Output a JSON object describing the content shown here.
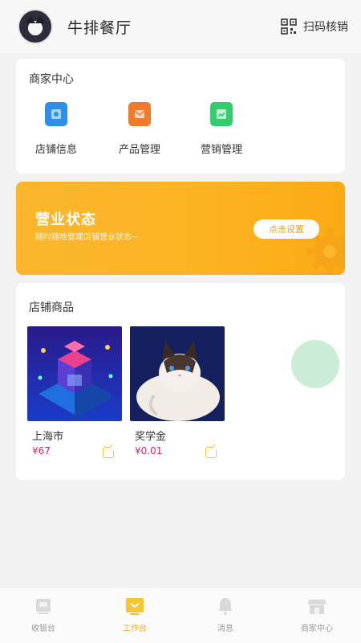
{
  "header": {
    "shop_name": "牛排餐厅",
    "scan_label": "扫码核销"
  },
  "merchant_center": {
    "title": "商家中心",
    "tools": [
      {
        "label": "店铺信息",
        "icon": "shop-info-icon",
        "color": "#2f8fe6"
      },
      {
        "label": "产品管理",
        "icon": "product-manage-icon",
        "color": "#f07a2c"
      },
      {
        "label": "营销管理",
        "icon": "marketing-icon",
        "color": "#33cc6e"
      }
    ]
  },
  "business_status": {
    "title": "营业状态",
    "subtitle": "随时随地管理店铺营业状态~",
    "button_label": "点击设置"
  },
  "products": {
    "title": "店铺商品",
    "items": [
      {
        "name": "上海市",
        "price": "¥67"
      },
      {
        "name": "奖学金",
        "price": "¥0.01"
      }
    ]
  },
  "tabbar": {
    "items": [
      {
        "label": "收银台",
        "icon": "cashier-icon",
        "active": false
      },
      {
        "label": "工作台",
        "icon": "workbench-icon",
        "active": true
      },
      {
        "label": "消息",
        "icon": "bell-icon",
        "active": false
      },
      {
        "label": "商家中心",
        "icon": "store-icon",
        "active": false
      }
    ]
  },
  "colors": {
    "accent": "#f2b318",
    "price": "#e0206b",
    "banner": "#fbb62d"
  }
}
